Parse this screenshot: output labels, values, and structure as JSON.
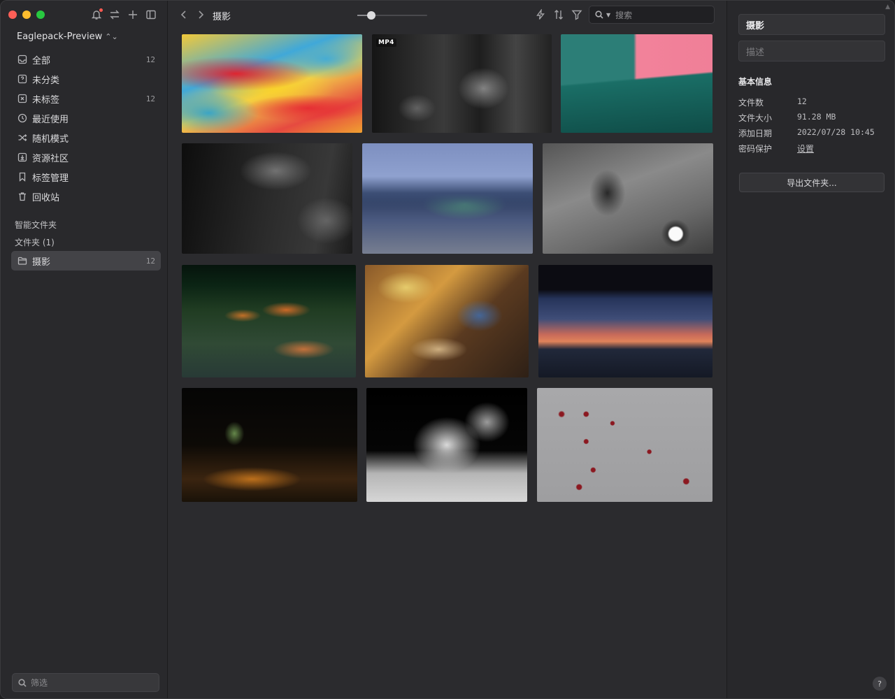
{
  "sidebar": {
    "library_name": "Eaglepack-Preview",
    "nav": [
      {
        "label": "全部",
        "count": "12",
        "icon": "inbox-icon"
      },
      {
        "label": "未分类",
        "count": "",
        "icon": "question-box-icon"
      },
      {
        "label": "未标签",
        "count": "12",
        "icon": "untagged-icon"
      },
      {
        "label": "最近使用",
        "count": "",
        "icon": "clock-icon"
      },
      {
        "label": "随机模式",
        "count": "",
        "icon": "shuffle-icon"
      },
      {
        "label": "资源社区",
        "count": "",
        "icon": "download-box-icon"
      },
      {
        "label": "标签管理",
        "count": "",
        "icon": "bookmark-icon"
      },
      {
        "label": "回收站",
        "count": "",
        "icon": "trash-icon"
      }
    ],
    "smart_folders_label": "智能文件夹",
    "folders_label": "文件夹 (1)",
    "folders": [
      {
        "label": "摄影",
        "count": "12",
        "icon": "folder-icon"
      }
    ],
    "filter_placeholder": "筛选"
  },
  "toolbar": {
    "title": "摄影",
    "zoom_level": 0.2,
    "search_placeholder": "搜索"
  },
  "grid": {
    "items": [
      {
        "badge": ""
      },
      {
        "badge": "MP4"
      },
      {
        "badge": ""
      },
      {
        "badge": ""
      },
      {
        "badge": ""
      },
      {
        "badge": ""
      },
      {
        "badge": ""
      },
      {
        "badge": ""
      },
      {
        "badge": ""
      },
      {
        "badge": ""
      },
      {
        "badge": ""
      },
      {
        "badge": ""
      }
    ]
  },
  "inspector": {
    "folder_name": "摄影",
    "description_placeholder": "描述",
    "section_title": "基本信息",
    "info": [
      {
        "key": "文件数",
        "value": "12"
      },
      {
        "key": "文件大小",
        "value": "91.28 MB"
      },
      {
        "key": "添加日期",
        "value": "2022/07/28 10:45"
      },
      {
        "key": "密码保护",
        "value": "设置"
      }
    ],
    "export_label": "导出文件夹...",
    "help_label": "?"
  },
  "colors": {
    "active_bg": "#434347",
    "accent_red": "#fe5f57",
    "accent_yellow": "#febc2e",
    "accent_green": "#28c840"
  }
}
